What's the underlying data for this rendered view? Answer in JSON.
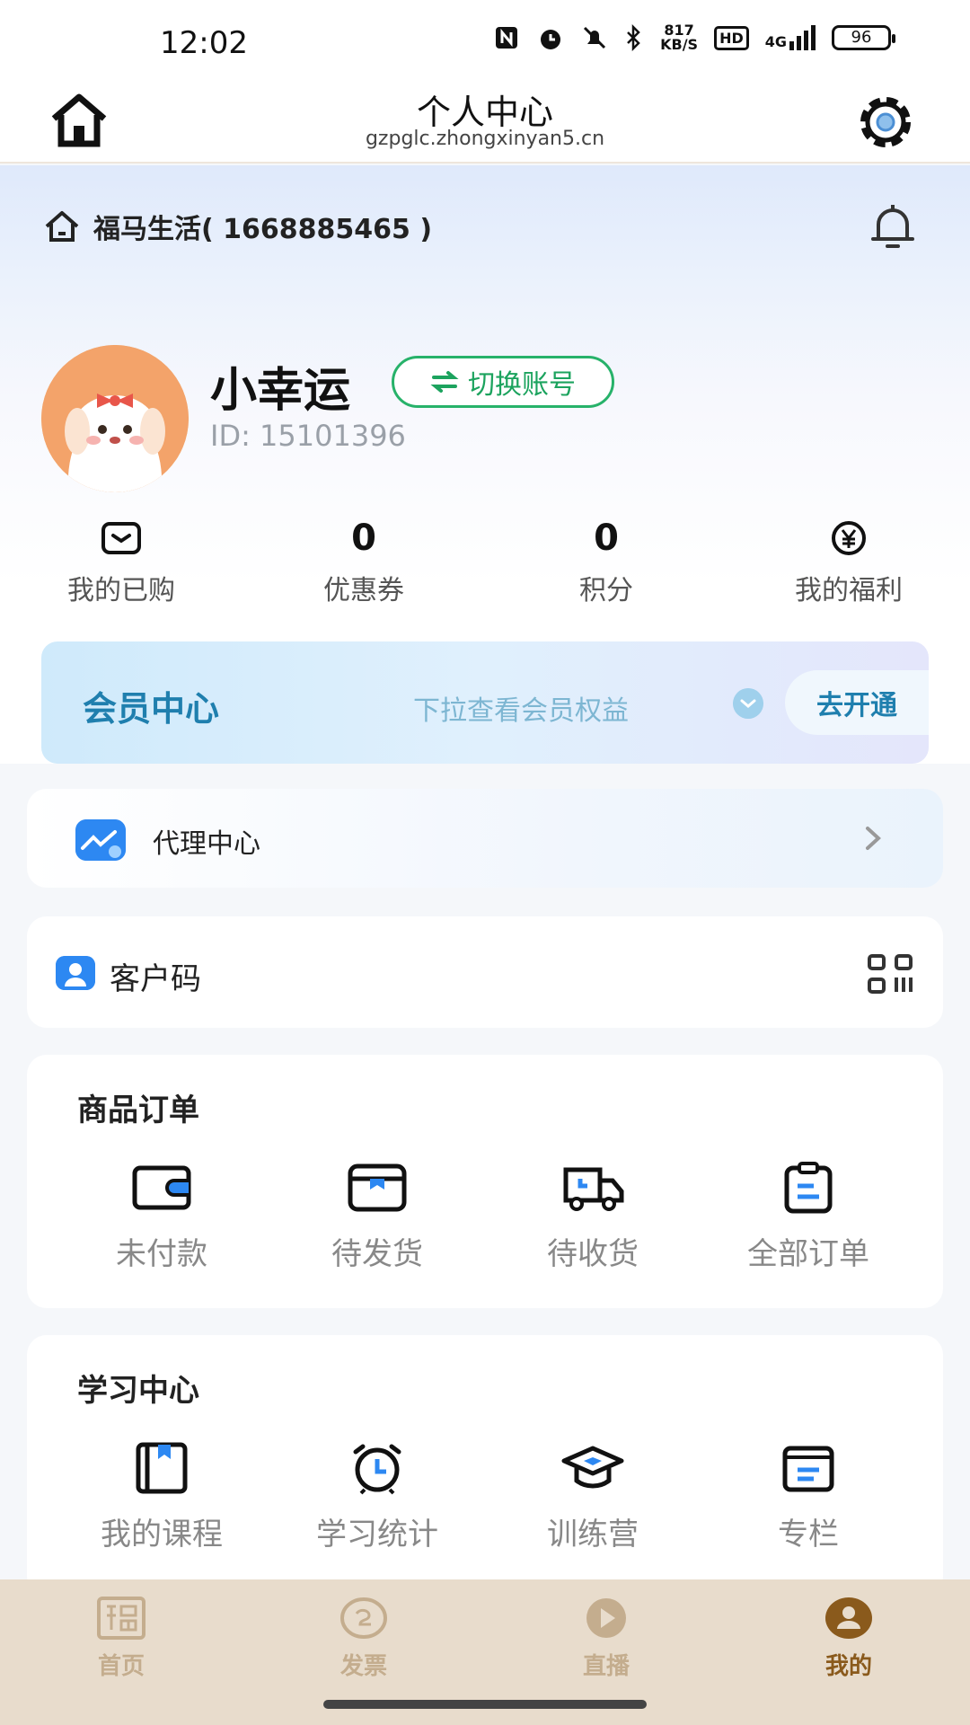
{
  "status_bar": {
    "time": "12:02",
    "net_speed_value": "817",
    "net_speed_unit": "KB/S",
    "hd": "HD",
    "signal": "4G",
    "battery": "96"
  },
  "header": {
    "title": "个人中心",
    "url": "gzpglc.zhongxinyan5.cn",
    "home_icon": "home-icon",
    "settings_icon": "gear-icon"
  },
  "shop": {
    "name": "福马生活( 1668885465 )"
  },
  "profile": {
    "username": "小幸运",
    "switch_account": "切换账号",
    "id_text": "ID: 15101396"
  },
  "stats": [
    {
      "icon": "purchased-icon",
      "value": "",
      "label": "我的已购"
    },
    {
      "icon": "",
      "value": "0",
      "label": "优惠券"
    },
    {
      "icon": "",
      "value": "0",
      "label": "积分"
    },
    {
      "icon": "yen-icon",
      "value": "",
      "label": "我的福利"
    }
  ],
  "vip": {
    "title": "会员中心",
    "hint": "下拉查看会员权益",
    "button": "去开通"
  },
  "agent": {
    "label": "代理中心"
  },
  "customer_code": {
    "label": "客户码"
  },
  "orders": {
    "title": "商品订单",
    "items": [
      {
        "label": "未付款",
        "icon": "wallet-icon"
      },
      {
        "label": "待发货",
        "icon": "box-icon"
      },
      {
        "label": "待收货",
        "icon": "truck-icon"
      },
      {
        "label": "全部订单",
        "icon": "clipboard-icon"
      }
    ]
  },
  "study": {
    "title": "学习中心",
    "items": [
      {
        "label": "我的课程",
        "icon": "book-icon"
      },
      {
        "label": "学习统计",
        "icon": "alarm-clock-icon"
      },
      {
        "label": "训练营",
        "icon": "graduation-cap-icon"
      },
      {
        "label": "专栏",
        "icon": "column-icon"
      }
    ]
  },
  "tabs": [
    {
      "label": "首页",
      "active": false
    },
    {
      "label": "发票",
      "active": false
    },
    {
      "label": "直播",
      "active": false
    },
    {
      "label": "我的",
      "active": true
    }
  ],
  "colors": {
    "accent_green": "#27b26a",
    "vip_blue": "#1f7fae",
    "icon_blue": "#2d88f2",
    "tab_bg": "#e8dccc",
    "tab_active": "#8a5a1c"
  }
}
